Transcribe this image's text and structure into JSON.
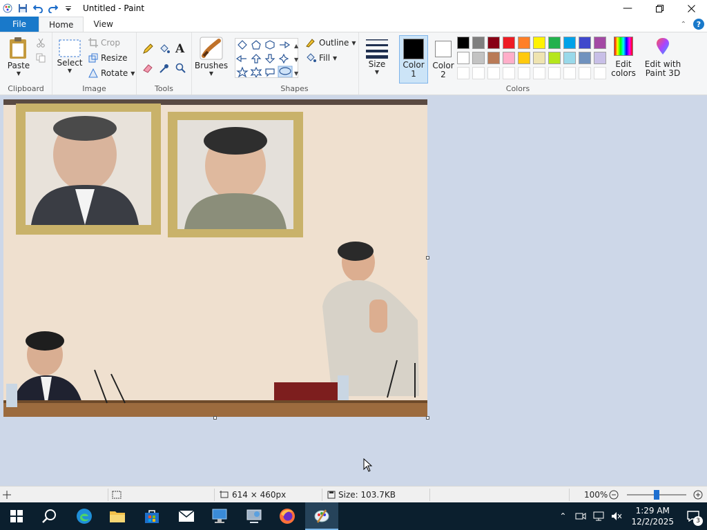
{
  "window": {
    "title": "Untitled - Paint"
  },
  "tabs": {
    "file": "File",
    "home": "Home",
    "view": "View"
  },
  "ribbon": {
    "clipboard": {
      "paste": "Paste",
      "label": "Clipboard"
    },
    "image": {
      "select": "Select",
      "crop": "Crop",
      "resize": "Resize",
      "rotate": "Rotate",
      "label": "Image"
    },
    "tools": {
      "label": "Tools"
    },
    "brushes": "Brushes",
    "shapes": {
      "outline": "Outline",
      "fill": "Fill",
      "label": "Shapes"
    },
    "size": "Size",
    "color1": {
      "line1": "Color",
      "line2": "1"
    },
    "color2": {
      "line1": "Color",
      "line2": "2"
    },
    "colors": {
      "label": "Colors",
      "row1": [
        "#000000",
        "#7f7f7f",
        "#880015",
        "#ed1c24",
        "#ff7f27",
        "#fff200",
        "#22b14c",
        "#00a2e8",
        "#3f48cc",
        "#a349a4"
      ],
      "row2": [
        "#ffffff",
        "#c3c3c3",
        "#b97a57",
        "#ffaec9",
        "#ffc90e",
        "#efe4b0",
        "#b5e61d",
        "#99d9ea",
        "#7092be",
        "#c8bfe7"
      ]
    },
    "edit_colors": {
      "line1": "Edit",
      "line2": "colors"
    },
    "paint3d": {
      "line1": "Edit with",
      "line2": "Paint 3D"
    }
  },
  "status": {
    "dimensions": "614 × 460px",
    "size": "Size: 103.7KB",
    "zoom": "100%",
    "zoom_level": 0.5
  },
  "taskbar": {
    "time": "1:29 AM",
    "date": "12/2/2025",
    "notifications": "3"
  }
}
